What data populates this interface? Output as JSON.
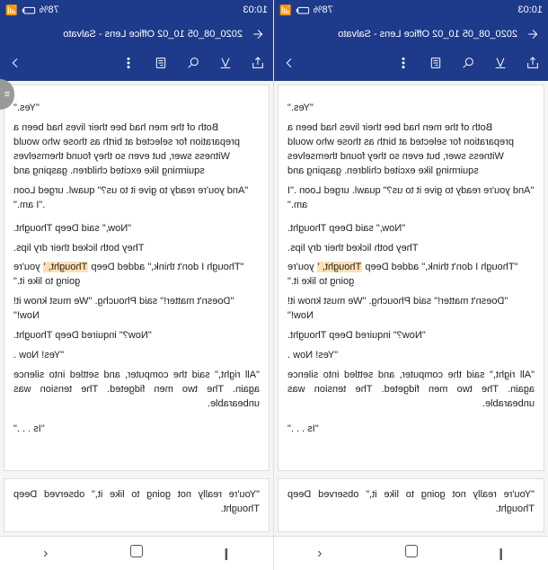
{
  "status": {
    "time": "10:03",
    "battery": "78%",
    "signal": "▮▮▮",
    "wifi": "◈"
  },
  "header": {
    "title": "2020_08_05 10_02 Office Lens - Salvato"
  },
  "document": {
    "p1": "\"Yes.\"",
    "p2": "Both of the men had bee their lives had been a preparation for selected at birth as those who would Witness swer, but even so they found themselves squirming like excited children. gasping and",
    "p3": "\"And you're ready to give it to us?\" quawl. urged Loon .\"I am.\"",
    "p4": "\"Now,\" said Deep Thought.",
    "p5": "They both licked their dry lips.",
    "p6a": "\"Though I don't think,\" added Deep ",
    "p6b": "Thought, '",
    "p6c": " you're going to like it.\"",
    "p7": "\"Doesn't matter!\" said Phouchg. \"We must know it! Now!\"",
    "p8": "\"Now?\" inquired Deep Thought.",
    "p9": "\"Yes! Now .",
    "p10": "\"All right,\" said the computer, and settled into silence again. The two men fidgeted. The tension was unbearable.",
    "p11": "\"Is . . .\"",
    "sec1": "\"You're really not going to like it,\" observed Deep Thought."
  }
}
